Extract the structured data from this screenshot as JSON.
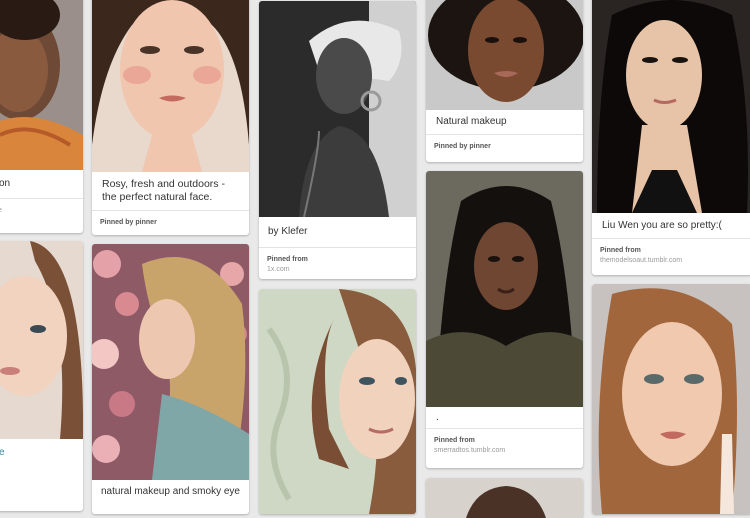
{
  "pins": [
    {
      "id": "p1",
      "desc": "on",
      "src_label": "",
      "src_site": "e"
    },
    {
      "id": "p2",
      "desc": "Rosy, fresh and outdoors - the perfect natural face.",
      "src_label": "Pinned by",
      "src_site": "pinner"
    },
    {
      "id": "p3",
      "desc": "by Klefer",
      "src_label": "Pinned from",
      "src_site": "1x.com"
    },
    {
      "id": "p4",
      "desc": "Natural makeup",
      "src_label": "Pinned by",
      "src_site": "pinner"
    },
    {
      "id": "p5",
      "desc": "Liu Wen you are so pretty:(",
      "src_label": "Pinned from",
      "src_site": "themodelsoaut.tumblr.com"
    },
    {
      "id": "p6",
      "desc": "e",
      "src_label": "",
      "src_site": ""
    },
    {
      "id": "p7",
      "desc": "natural makeup and smoky eye",
      "src_label": "",
      "src_site": ""
    },
    {
      "id": "p8",
      "desc": "",
      "src_label": "",
      "src_site": ""
    },
    {
      "id": "p9",
      "desc": ".",
      "src_label": "Pinned from",
      "src_site": "smerradtos.tumblr.com"
    },
    {
      "id": "p10",
      "desc": "",
      "src_label": "",
      "src_site": ""
    },
    {
      "id": "p11",
      "desc": "",
      "src_label": "",
      "src_site": ""
    }
  ],
  "colors": {
    "page_bg": "#e9e9e9",
    "card_bg": "#ffffff",
    "text": "#333333",
    "muted": "#9a9a9a"
  }
}
